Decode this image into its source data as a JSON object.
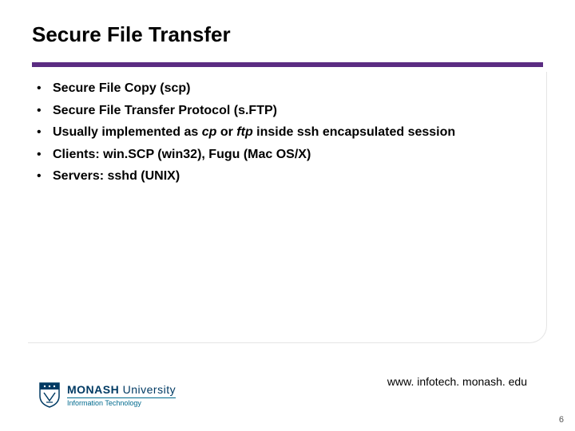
{
  "title": "Secure File Transfer",
  "bullets": [
    {
      "pre": "Secure File Copy (scp)",
      "em": "",
      "post": ""
    },
    {
      "pre": "Secure File Transfer Protocol (s.FTP)",
      "em": "",
      "post": ""
    },
    {
      "pre": "Usually implemented as ",
      "em": "cp",
      "mid": " or ",
      "em2": "ftp",
      "post": " inside ssh encapsulated session"
    },
    {
      "pre": "Clients: win.SCP (win32), Fugu (Mac OS/X)",
      "em": "",
      "post": ""
    },
    {
      "pre": "Servers: sshd (UNIX)",
      "em": "",
      "post": ""
    }
  ],
  "footer": {
    "url": "www. infotech. monash. edu",
    "page_number": "6",
    "logo_main_bold": "MONASH",
    "logo_main_rest": " University",
    "logo_sub": "Information Technology"
  },
  "colors": {
    "rule": "#5b2c82",
    "logo_blue": "#003a63",
    "logo_teal": "#006a8e"
  }
}
